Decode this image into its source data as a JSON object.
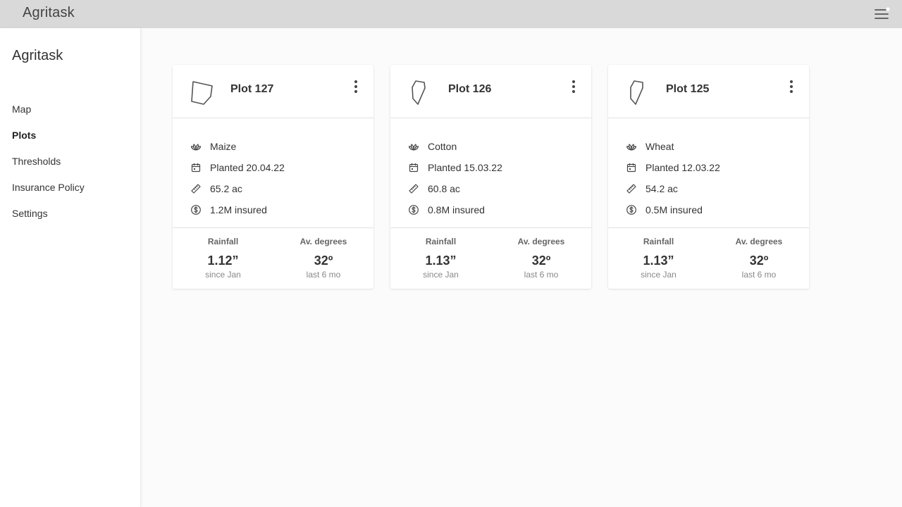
{
  "topbar": {
    "title": "Agritask",
    "menu_icon": "hamburger-menu-icon"
  },
  "sidebar": {
    "brand": "Agritask",
    "items": [
      {
        "label": "Map",
        "active": false
      },
      {
        "label": "Plots",
        "active": true
      },
      {
        "label": "Thresholds",
        "active": false
      },
      {
        "label": "Insurance Policy",
        "active": false
      },
      {
        "label": "Settings",
        "active": false
      }
    ]
  },
  "cards": [
    {
      "name": "Plot 127",
      "crop": "Maize",
      "planted": "Planted 20.04.22",
      "area": "65.2 ac",
      "insured": "1.2M insured",
      "rainfall_label": "Rainfall",
      "rainfall_value": "1.12”",
      "rainfall_sub": "since Jan",
      "degrees_label": "Av. degrees",
      "degrees_value": "32º",
      "degrees_sub": "last 6 mo"
    },
    {
      "name": "Plot 126",
      "crop": "Cotton",
      "planted": "Planted 15.03.22",
      "area": "60.8 ac",
      "insured": "0.8M insured",
      "rainfall_label": "Rainfall",
      "rainfall_value": "1.13”",
      "rainfall_sub": "since Jan",
      "degrees_label": "Av. degrees",
      "degrees_value": "32º",
      "degrees_sub": "last 6 mo"
    },
    {
      "name": "Plot 125",
      "crop": "Wheat",
      "planted": "Planted 12.03.22",
      "area": "54.2 ac",
      "insured": "0.5M insured",
      "rainfall_label": "Rainfall",
      "rainfall_value": "1.13”",
      "rainfall_sub": "since Jan",
      "degrees_label": "Av. degrees",
      "degrees_value": "32º",
      "degrees_sub": "last 6 mo"
    }
  ],
  "icons": {
    "crop": "leaf-icon",
    "planted": "calendar-icon",
    "area": "ruler-icon",
    "insured": "dollar-coin-icon",
    "menu": "kebab-menu-icon"
  }
}
